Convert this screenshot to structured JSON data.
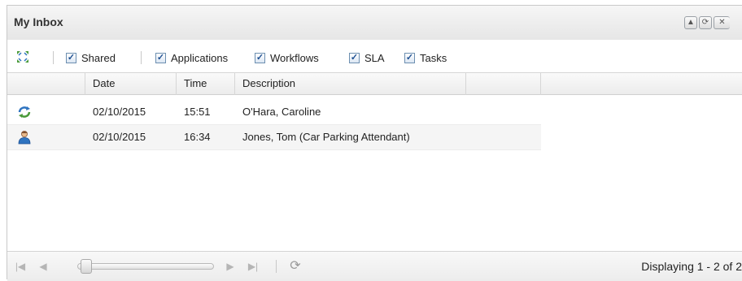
{
  "panel": {
    "title": "My Inbox",
    "tools": [
      {
        "icon": "collapse-icon",
        "glyph": "▲"
      },
      {
        "icon": "refresh-icon",
        "glyph": "⟳"
      },
      {
        "icon": "close-icon",
        "glyph": "✕"
      }
    ]
  },
  "toolbar": {
    "expand_icon": "expand-arrows-icon",
    "filters": [
      {
        "label": "Shared",
        "checked": true
      },
      {
        "label": "Applications",
        "checked": true
      },
      {
        "label": "Workflows",
        "checked": true
      },
      {
        "label": "SLA",
        "checked": true
      },
      {
        "label": "Tasks",
        "checked": true
      }
    ]
  },
  "grid": {
    "columns": [
      "Date",
      "Time",
      "Description"
    ],
    "rows": [
      {
        "icon": "workflow-refresh-icon",
        "date": "02/10/2015",
        "time": "15:51",
        "description": "O'Hara, Caroline"
      },
      {
        "icon": "user-icon",
        "date": "02/10/2015",
        "time": "16:34",
        "description": "Jones, Tom (Car Parking Attendant)"
      }
    ]
  },
  "footer": {
    "status": "Displaying 1 - 2 of 2",
    "slider_position": 0
  },
  "colors": {
    "accent": "#1d4f91",
    "icon_green": "#4a9a3a",
    "icon_blue": "#2f74c0"
  }
}
